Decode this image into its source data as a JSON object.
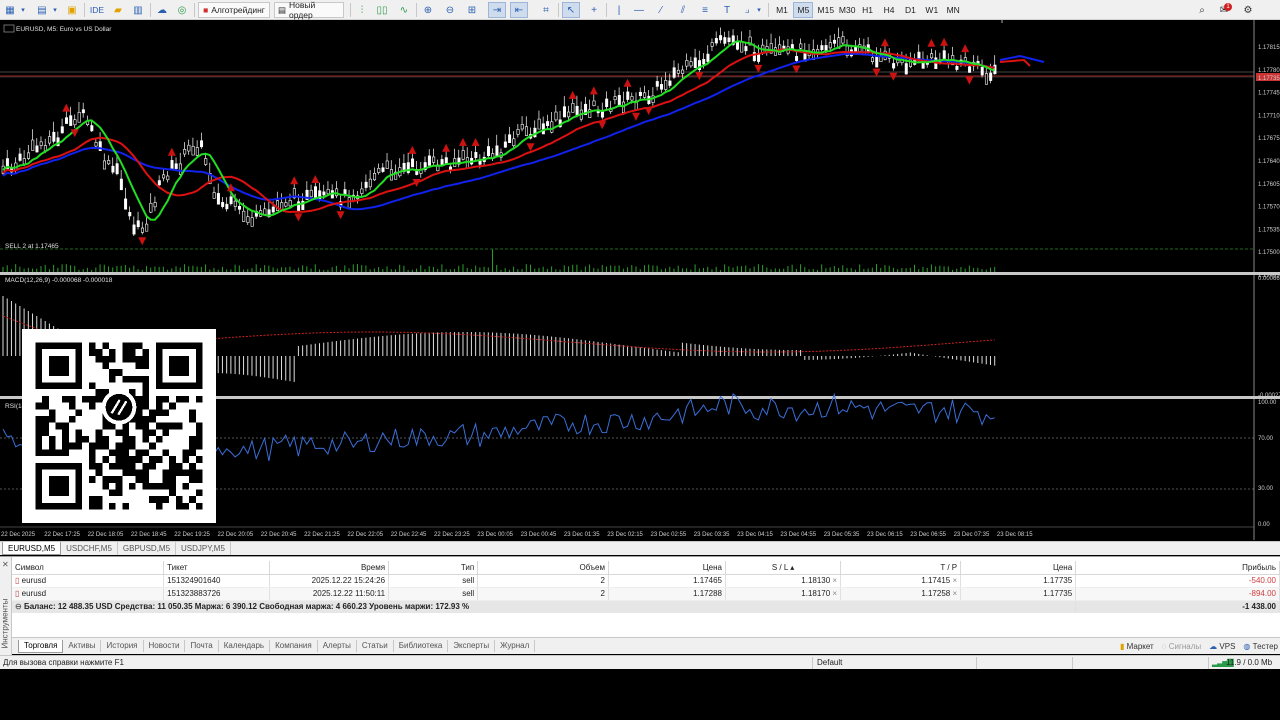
{
  "toolbar": {
    "algotrading": "Алготрейдинг",
    "new_order": "Новый ордер",
    "ide": "IDE",
    "timeframes": [
      "M1",
      "M5",
      "M15",
      "M30",
      "H1",
      "H4",
      "D1",
      "W1",
      "MN"
    ],
    "active_timeframe": "M5",
    "notification_count": "1"
  },
  "chart": {
    "title": "EURUSD, M5:  Euro vs US Dollar",
    "order_line_label": "SELL 2 at 1.17465",
    "macd_label": "MACD(12,26,9) -0.000068 -0.000018",
    "rsi_label": "RSI(14)",
    "price_axis": [
      "1.17815",
      "1.17780",
      "1.17745",
      "1.17710",
      "1.17675",
      "1.17640",
      "1.17605",
      "1.17570",
      "1.17535",
      "1.17500",
      "1.17465"
    ],
    "current_price_tag": "1.17735",
    "macd_axis_top": "0.000660",
    "macd_axis_bottom": "-0.000276",
    "rsi_axis": [
      "100.00",
      "70.00",
      "30.00",
      "0.00"
    ],
    "time_axis": [
      "22 Dec 2025",
      "22 Dec 17:25",
      "22 Dec 18:05",
      "22 Dec 18:45",
      "22 Dec 19:25",
      "22 Dec 20:05",
      "22 Dec 20:45",
      "22 Dec 21:25",
      "22 Dec 22:05",
      "22 Dec 22:45",
      "22 Dec 23:25",
      "23 Dec 00:05",
      "23 Dec 00:45",
      "23 Dec 01:35",
      "23 Dec 02:15",
      "23 Dec 02:55",
      "23 Dec 03:35",
      "23 Dec 04:15",
      "23 Dec 04:55",
      "23 Dec 05:35",
      "23 Dec 06:15",
      "23 Dec 06:55",
      "23 Dec 07:35",
      "23 Dec 08:15"
    ],
    "colors": {
      "fast_ma": "#22dd22",
      "mid_ma": "#dd1111",
      "slow_ma": "#1122ee",
      "rsi": "#3a6fd8",
      "macd_signal": "#cc2222",
      "order_line": "#2a8a2a"
    }
  },
  "symbol_tabs": [
    "EURUSD,M5",
    "USDCHF,M5",
    "GBPUSD,M5",
    "USDJPY,M5"
  ],
  "terminal": {
    "side_label": "Инструменты",
    "columns": [
      "Символ",
      "Тикет",
      "Время",
      "Тип",
      "Объем",
      "Цена",
      "S / L",
      "T / P",
      "Цена",
      "Прибыль"
    ],
    "rows": [
      [
        "eurusd",
        "151324901640",
        "2025.12.22 15:24:26",
        "sell",
        "2",
        "1.17465",
        "1.18130",
        "1.17415",
        "1.17735",
        "-540.00"
      ],
      [
        "eurusd",
        "151323883726",
        "2025.12.22 11:50:11",
        "sell",
        "2",
        "1.17288",
        "1.18170",
        "1.17258",
        "1.17735",
        "-894.00"
      ]
    ],
    "summary": "Баланс: 12 488.35 USD  Средства: 11 050.35  Маржа: 6 390.12  Свободная маржа: 4 660.23  Уровень маржи: 172.93 %",
    "summary_total": "-1 438.00",
    "tabs": [
      "Торговля",
      "Активы",
      "История",
      "Новости",
      "Почта",
      "Календарь",
      "Компания",
      "Алерты",
      "Статьи",
      "Библиотека",
      "Эксперты",
      "Журнал"
    ],
    "right_items": [
      "Маркет",
      "Сигналы",
      "VPS",
      "Тестер"
    ]
  },
  "statusbar": {
    "help": "Для вызова справки нажмите F1",
    "profile": "Default",
    "connection": "11.9 / 0.0 Mb"
  }
}
